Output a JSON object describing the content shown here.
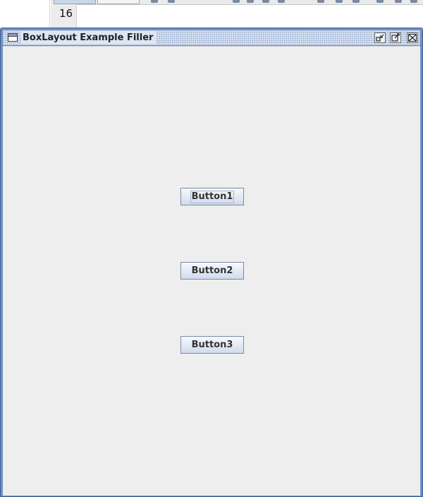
{
  "ide": {
    "line_number": "16"
  },
  "window": {
    "title": "BoxLayout Example Filler",
    "icons": {
      "frame": "window-icon",
      "iconify": "iconify-icon",
      "maximize": "maximize-icon",
      "close": "close-icon"
    }
  },
  "buttons": [
    {
      "label": "Button1",
      "focused": true
    },
    {
      "label": "Button2",
      "focused": false
    },
    {
      "label": "Button3",
      "focused": false
    }
  ],
  "colors": {
    "frame_border": "#6f8fc4",
    "content_background": "#eeeeee",
    "button_border": "#7a8aa4"
  }
}
